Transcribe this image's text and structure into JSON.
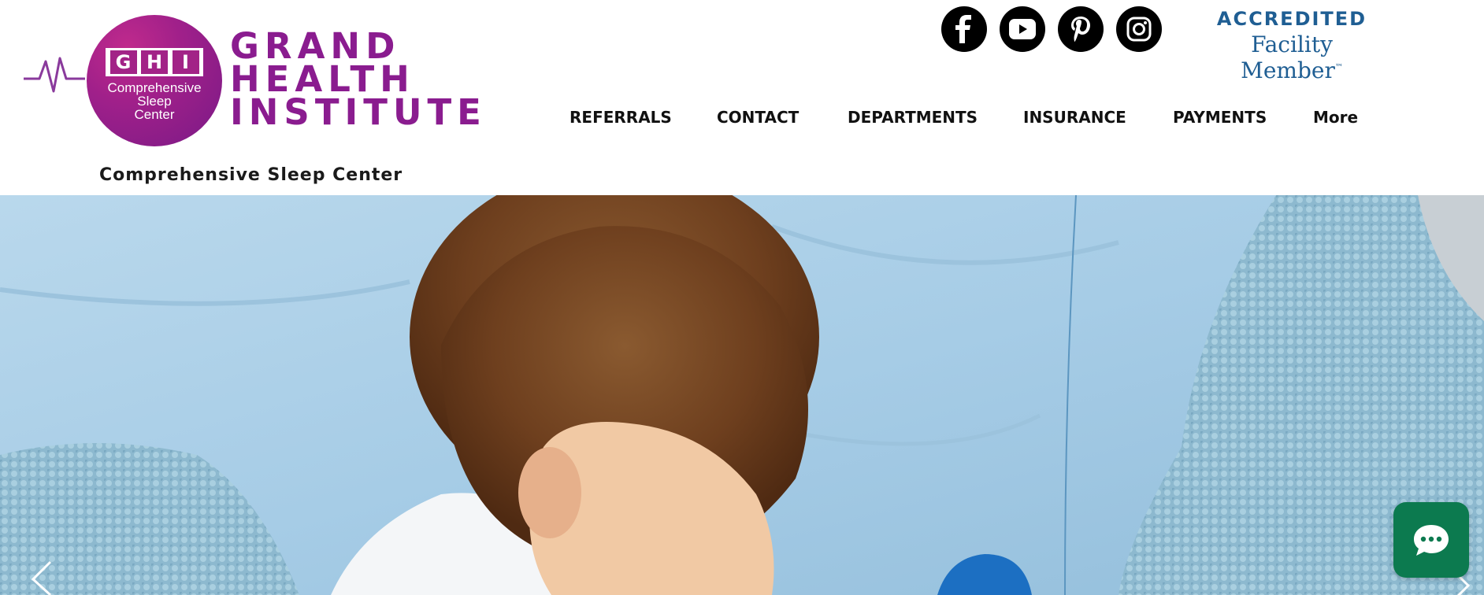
{
  "logo": {
    "badge_letters": [
      "G",
      "H",
      "I"
    ],
    "badge_lines": [
      "Comprehensive",
      "Sleep",
      "Center"
    ],
    "brand_lines": [
      "GRAND",
      "HEALTH",
      "INSTITUTE"
    ],
    "subtitle": "Comprehensive Sleep Center"
  },
  "social": [
    {
      "name": "facebook",
      "icon": "facebook-icon"
    },
    {
      "name": "youtube",
      "icon": "youtube-icon"
    },
    {
      "name": "pinterest",
      "icon": "pinterest-icon"
    },
    {
      "name": "instagram",
      "icon": "instagram-icon"
    }
  ],
  "accreditation": {
    "line1": "ACCREDITED",
    "line2": "Facility Member",
    "mark": "™"
  },
  "nav": {
    "items": [
      "REFERRALS",
      "CONTACT",
      "DEPARTMENTS",
      "INSURANCE",
      "PAYMENTS",
      "More"
    ]
  },
  "hero": {
    "icons": {
      "prev": "chevron-left-icon",
      "next": "chevron-right-icon"
    }
  },
  "chat": {
    "icon": "chat-bubble-icon"
  },
  "colors": {
    "brand_purple": "#8a1c8f",
    "accent_blue": "#1f5e93",
    "chat_green": "#0c7a4f",
    "hero_blue": "#a8cde5"
  }
}
